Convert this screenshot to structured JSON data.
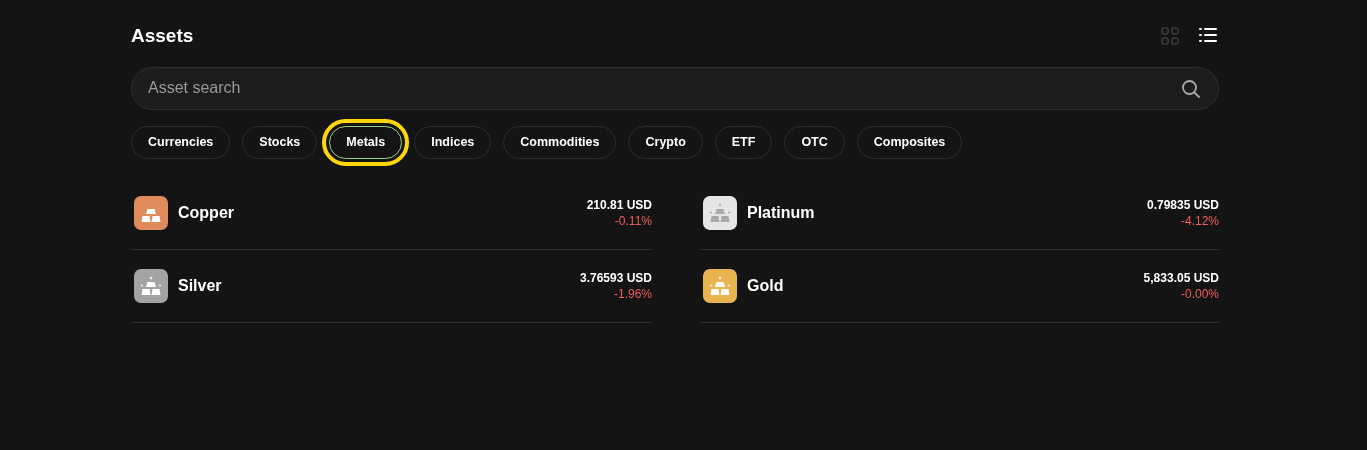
{
  "title": "Assets",
  "views": [
    {
      "kind": "grid",
      "selected": false
    },
    {
      "kind": "list",
      "selected": true
    }
  ],
  "search": {
    "placeholder": "Asset search"
  },
  "categories": [
    {
      "label": "Currencies",
      "selected": false,
      "highlighted": false
    },
    {
      "label": "Stocks",
      "selected": false,
      "highlighted": false
    },
    {
      "label": "Metals",
      "selected": true,
      "highlighted": true
    },
    {
      "label": "Indices",
      "selected": false,
      "highlighted": false
    },
    {
      "label": "Commodities",
      "selected": false,
      "highlighted": false
    },
    {
      "label": "Crypto",
      "selected": false,
      "highlighted": false
    },
    {
      "label": "ETF",
      "selected": false,
      "highlighted": false
    },
    {
      "label": "OTC",
      "selected": false,
      "highlighted": false
    },
    {
      "label": "Composites",
      "selected": false,
      "highlighted": false
    }
  ],
  "assets": [
    {
      "name": "Copper",
      "price": "210.81 USD",
      "change": "-0.11%",
      "color": "#e08b5c",
      "shiny": false
    },
    {
      "name": "Platinum",
      "price": "0.79835 USD",
      "change": "-4.12%",
      "color": "#e6e6e6",
      "shiny": true
    },
    {
      "name": "Silver",
      "price": "3.76593 USD",
      "change": "-1.96%",
      "color": "#a3a3a3",
      "shiny": true
    },
    {
      "name": "Gold",
      "price": "5,833.05 USD",
      "change": "-0.00%",
      "color": "#e8b44e",
      "shiny": true
    }
  ]
}
